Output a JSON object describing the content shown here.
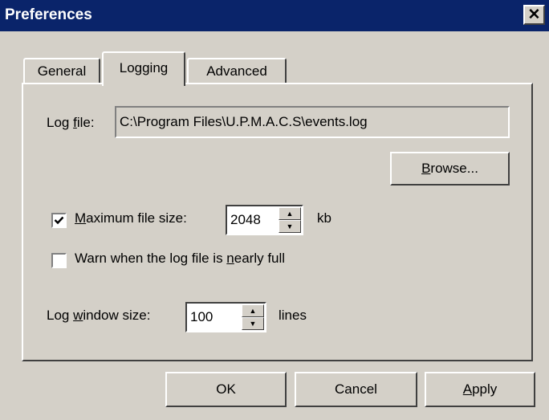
{
  "window": {
    "title": "Preferences",
    "close_glyph": "✕"
  },
  "tabs": [
    {
      "label": "General",
      "active": false
    },
    {
      "label": "Logging",
      "active": true
    },
    {
      "label": "Advanced",
      "active": false
    }
  ],
  "log_file": {
    "label_before": "Log ",
    "label_mnemonic": "f",
    "label_after": "ile:",
    "value": "C:\\Program Files\\U.P.M.A.C.S\\events.log",
    "browse_mnemonic": "B",
    "browse_rest": "rowse..."
  },
  "max_size": {
    "checked": true,
    "label_mnemonic": "M",
    "label_rest": "aximum file size:",
    "value": "2048",
    "unit": "kb"
  },
  "warn_full": {
    "checked": false,
    "label_before": "Warn when the log file is ",
    "label_mnemonic": "n",
    "label_after": "early full"
  },
  "window_size": {
    "label_before": "Log ",
    "label_mnemonic": "w",
    "label_after": "indow size:",
    "value": "100",
    "unit": "lines"
  },
  "buttons": {
    "ok": "OK",
    "cancel": "Cancel",
    "apply_mnemonic": "A",
    "apply_rest": "pply"
  },
  "colors": {
    "titlebar": "#0a246a",
    "face": "#d4d0c8",
    "highlight": "#ffffff",
    "shadow": "#404040"
  }
}
